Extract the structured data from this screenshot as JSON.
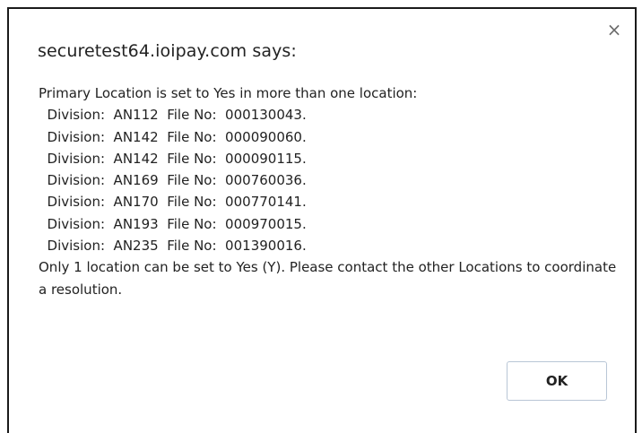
{
  "dialog": {
    "close_symbol": "×",
    "title": "securetest64.ioipay.com says:",
    "intro": "Primary Location is set to Yes in more than one location:",
    "entries": [
      "  Division:  AN112  File No:  000130043.",
      "  Division:  AN142  File No:  000090060.",
      "  Division:  AN142  File No:  000090115.",
      "  Division:  AN169  File No:  000760036.",
      "  Division:  AN170  File No:  000770141.",
      "  Division:  AN193  File No:  000970015.",
      "  Division:  AN235  File No:  001390016."
    ],
    "footer": "Only 1 location can be set to Yes (Y).  Please contact the other Locations to coordinate a resolution.",
    "ok_label": "OK"
  },
  "icons": {
    "close": "close-icon"
  }
}
